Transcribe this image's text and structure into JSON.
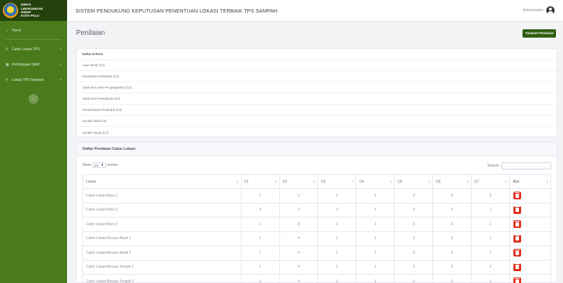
{
  "sidebar": {
    "brand": [
      "DINAS",
      "LINGKUNGAN",
      "HIDUP",
      "KOTA PALU"
    ],
    "items": [
      {
        "label": "Home",
        "icon": "home-icon"
      },
      {
        "label": "Calon Lokasi TPS",
        "icon": "location-icon"
      },
      {
        "label": "Perhitungan SAW",
        "icon": "calculator-icon"
      },
      {
        "label": "Lokasi TPS Sampah",
        "icon": "location-icon"
      }
    ]
  },
  "topbar": {
    "title": "SISTEM PENDUKUNG KEPUTUSAN PENENTUAN LOKASI TERBAIK TPS SAMPAH",
    "user": "Administrator"
  },
  "page": {
    "title": "Penilaian",
    "add_button": "Tambah Penilaian"
  },
  "criteria": {
    "heading": "Daftar Kriteria",
    "items": [
      "Luas Tanah (C1)",
      "Kepadatan Penduduk (C2)",
      "Jarak Dari Jalur Pengangkutan (C3)",
      "Jarak Dari Pemukiman (C4)",
      "Kenyamanan Penduduk (C5)",
      "Kondisi lokal (C6)",
      "Kondisi Tanah (C7)"
    ]
  },
  "table": {
    "heading": "Daftar Penilaian Calon Lokasi",
    "show_label": "Show",
    "entries_value": "10",
    "entries_label": "entries",
    "search_label": "Search:",
    "columns": [
      "Lokasi",
      "C1",
      "C2",
      "C3",
      "C4",
      "C5",
      "C6",
      "C7",
      "Aksi"
    ],
    "rows": [
      {
        "lokasi": "Calon Lokasi Baru 1",
        "values": [
          "1",
          "3",
          "1",
          "1",
          "3",
          "3",
          "3"
        ]
      },
      {
        "lokasi": "Calon Lokasi Baru 2",
        "values": [
          "3",
          "3",
          "1",
          "1",
          "3",
          "3",
          "1"
        ]
      },
      {
        "lokasi": "Calon Lokasi Baru 3",
        "values": [
          "1",
          "3",
          "1",
          "1",
          "3",
          "3",
          "1"
        ]
      },
      {
        "lokasi": "Calon Lokasi Besusu Barat 1",
        "values": [
          "1",
          "4",
          "1",
          "1",
          "3",
          "3",
          "1"
        ]
      },
      {
        "lokasi": "Calon Lokasi Besusu Barat 2",
        "values": [
          "1",
          "4",
          "1",
          "1",
          "3",
          "3",
          "2"
        ]
      },
      {
        "lokasi": "Calon Lokasi Besusu Tengah 1",
        "values": [
          "1",
          "4",
          "1",
          "1",
          "3",
          "3",
          "3"
        ]
      },
      {
        "lokasi": "Calon Lokasi Besusu Tengah 2",
        "values": [
          "1",
          "4",
          "1",
          "1",
          "3",
          "3",
          "3"
        ]
      }
    ]
  },
  "colors": {
    "sidebar": "#4a7a1c",
    "brand_bar": "#26420c",
    "primary_button": "#2f5f12",
    "delete_button": "#e02d1b"
  }
}
